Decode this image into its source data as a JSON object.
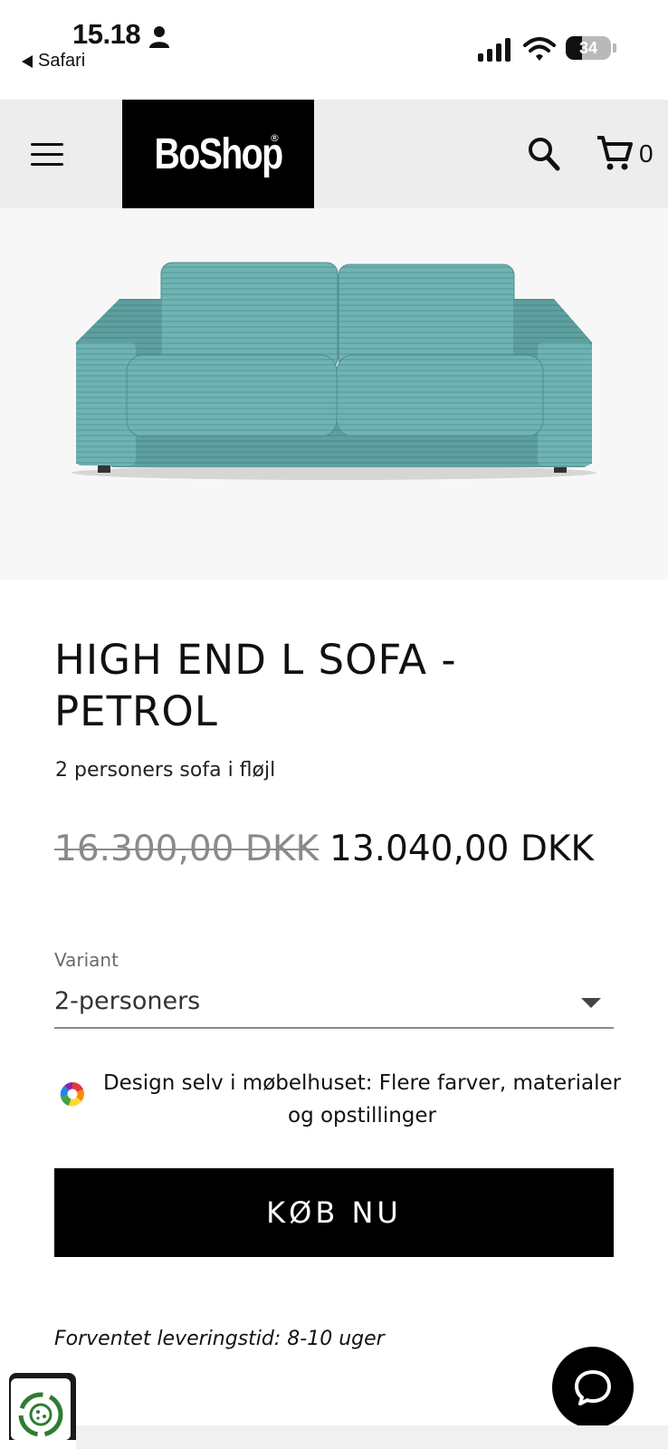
{
  "status_bar": {
    "time": "15.18",
    "back_app": "Safari",
    "battery": "34"
  },
  "header": {
    "logo": "BoShop",
    "logo_mark": "®",
    "cart_count": "0"
  },
  "product": {
    "title": "HIGH END L SOFA - PETROL",
    "subtitle": "2 personers sofa i fløjl",
    "price_original": "16.300,00 DKK",
    "price_sale": "13.040,00 DKK",
    "variant_label": "Variant",
    "variant_value": "2-personers",
    "design_note": "Design selv i møbelhuset: Flere farver, materialer og opstillinger",
    "buy_label": "KØB NU",
    "delivery": "Forventet leveringstid: 8-10 uger"
  },
  "colors": {
    "brand": "#000000",
    "header_bg": "#ededed",
    "sofa": "#6fb3b3"
  },
  "icons": [
    "person-icon",
    "signal-icon",
    "wifi-icon",
    "menu-icon",
    "search-icon",
    "cart-icon",
    "caret-down-icon",
    "color-wheel-icon",
    "chat-icon",
    "eco-badge-icon"
  ]
}
